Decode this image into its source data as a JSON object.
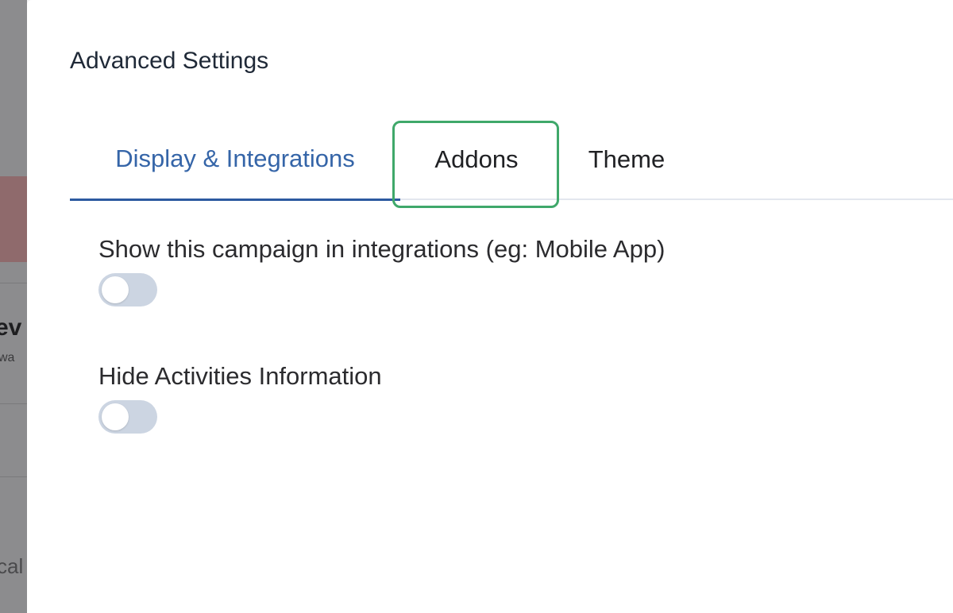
{
  "dialog": {
    "title": "Advanced Settings"
  },
  "tabs": [
    {
      "label": "Display & Integrations",
      "active": true
    },
    {
      "label": "Addons",
      "active": false,
      "highlighted": true
    },
    {
      "label": "Theme",
      "active": false
    }
  ],
  "settings": [
    {
      "label": "Show this campaign in integrations (eg: Mobile App)",
      "enabled": false
    },
    {
      "label": "Hide Activities Information",
      "enabled": false
    }
  ],
  "background": {
    "fragment_1": "ev",
    "fragment_2": "wa",
    "fragment_3": "cal"
  },
  "colors": {
    "active_tab": "#3565a8",
    "highlight": "#3fa86a",
    "toggle_off": "#ccd5e2"
  }
}
